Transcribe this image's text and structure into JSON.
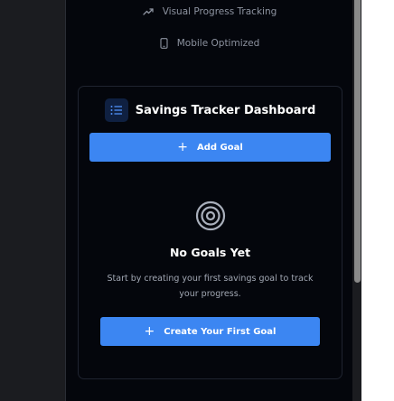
{
  "features": [
    {
      "label": "Visual Progress Tracking",
      "icon": "trending-up-icon"
    },
    {
      "label": "Mobile Optimized",
      "icon": "smartphone-icon"
    }
  ],
  "card": {
    "title": "Savings Tracker Dashboard",
    "header_icon": "list-icon",
    "add_goal_label": "Add Goal",
    "empty_state": {
      "icon": "target-icon",
      "title": "No Goals Yet",
      "description": "Start by creating your first savings goal to track your progress.",
      "cta_label": "Create Your First Goal"
    }
  },
  "colors": {
    "accent": "#3c86f2",
    "panel_background": "#04060c",
    "page_background": "#1b1c20"
  }
}
